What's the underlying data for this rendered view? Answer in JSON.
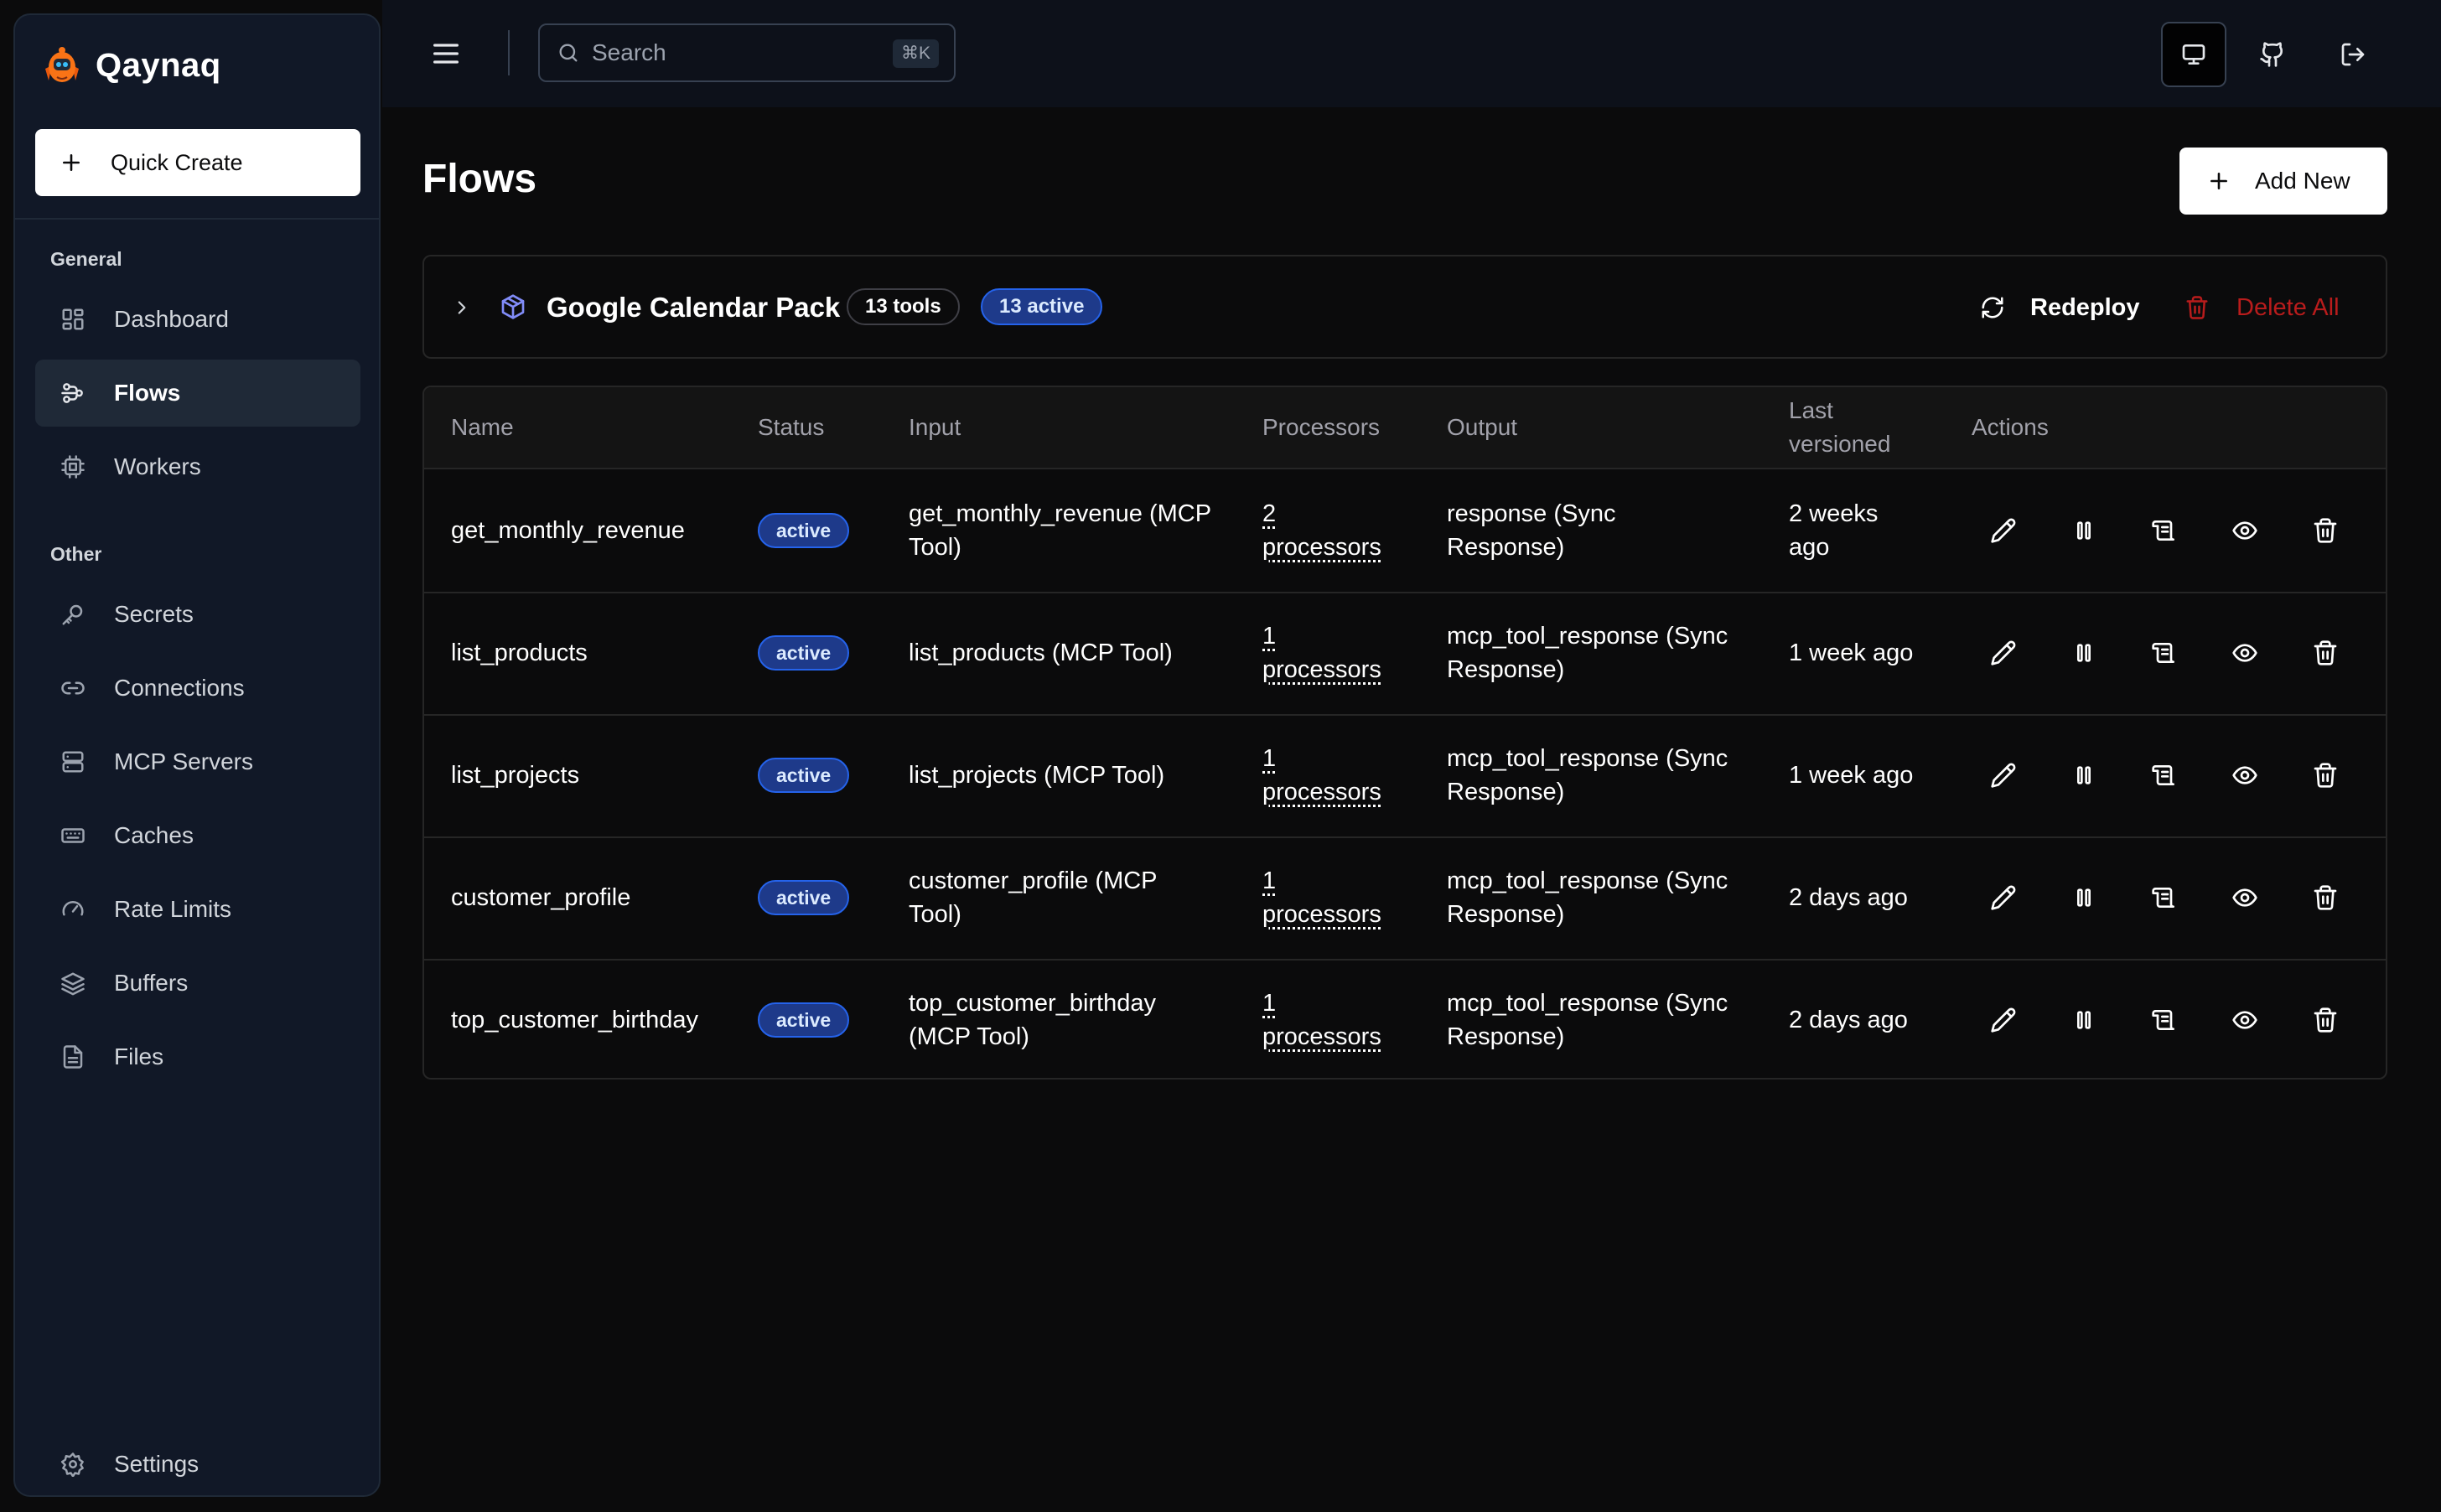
{
  "brand": {
    "name": "Qaynaq"
  },
  "sidebar": {
    "quick_create": "Quick Create",
    "general_label": "General",
    "other_label": "Other",
    "items": [
      {
        "label": "Dashboard",
        "icon": "dashboard-icon"
      },
      {
        "label": "Flows",
        "icon": "flows-icon",
        "active": true
      },
      {
        "label": "Workers",
        "icon": "cpu-icon"
      },
      {
        "label": "Secrets",
        "icon": "key-icon"
      },
      {
        "label": "Connections",
        "icon": "link-icon"
      },
      {
        "label": "MCP Servers",
        "icon": "server-icon"
      },
      {
        "label": "Caches",
        "icon": "keyboard-icon"
      },
      {
        "label": "Rate Limits",
        "icon": "gauge-icon"
      },
      {
        "label": "Buffers",
        "icon": "layers-icon"
      },
      {
        "label": "Files",
        "icon": "file-icon"
      }
    ],
    "settings": "Settings"
  },
  "topbar": {
    "search_placeholder": "Search",
    "search_shortcut": "⌘K"
  },
  "page": {
    "title": "Flows",
    "add_new": "Add New"
  },
  "pack": {
    "name": "Google Calendar Pack",
    "tools_badge": "13 tools",
    "active_badge": "13 active",
    "redeploy": "Redeploy",
    "delete_all": "Delete All"
  },
  "table": {
    "headers": {
      "name": "Name",
      "status": "Status",
      "input": "Input",
      "processors": "Processors",
      "output": "Output",
      "last_versioned_1": "Last",
      "last_versioned_2": "versioned",
      "actions": "Actions"
    },
    "rows": [
      {
        "name": "get_monthly_revenue",
        "status": "active",
        "input_1": "get_monthly_revenue (MCP",
        "input_2": "Tool)",
        "proc_1": "2",
        "proc_2": "processors",
        "output_1": "response (Sync",
        "output_2": "Response)",
        "last_1": "2 weeks",
        "last_2": "ago"
      },
      {
        "name": "list_products",
        "status": "active",
        "input_1": "list_products (MCP Tool)",
        "input_2": "",
        "proc_1": "1",
        "proc_2": "processors",
        "output_1": "mcp_tool_response (Sync",
        "output_2": "Response)",
        "last_1": "1 week ago",
        "last_2": ""
      },
      {
        "name": "list_projects",
        "status": "active",
        "input_1": "list_projects (MCP Tool)",
        "input_2": "",
        "proc_1": "1",
        "proc_2": "processors",
        "output_1": "mcp_tool_response (Sync",
        "output_2": "Response)",
        "last_1": "1 week ago",
        "last_2": ""
      },
      {
        "name": "customer_profile",
        "status": "active",
        "input_1": "customer_profile (MCP",
        "input_2": "Tool)",
        "proc_1": "1",
        "proc_2": "processors",
        "output_1": "mcp_tool_response (Sync",
        "output_2": "Response)",
        "last_1": "2 days ago",
        "last_2": ""
      },
      {
        "name": "top_customer_birthday",
        "status": "active",
        "input_1": "top_customer_birthday",
        "input_2": "(MCP Tool)",
        "proc_1": "1",
        "proc_2": "processors",
        "output_1": "mcp_tool_response (Sync",
        "output_2": "Response)",
        "last_1": "2 days ago",
        "last_2": ""
      }
    ],
    "row_actions": [
      "edit-icon",
      "pause-icon",
      "logs-icon",
      "view-icon",
      "trash-icon"
    ]
  },
  "colors": {
    "background": "#0b0b0c",
    "sidebar": "#111827",
    "active_badge": "#1e3a8a",
    "danger": "#b91c1c"
  }
}
